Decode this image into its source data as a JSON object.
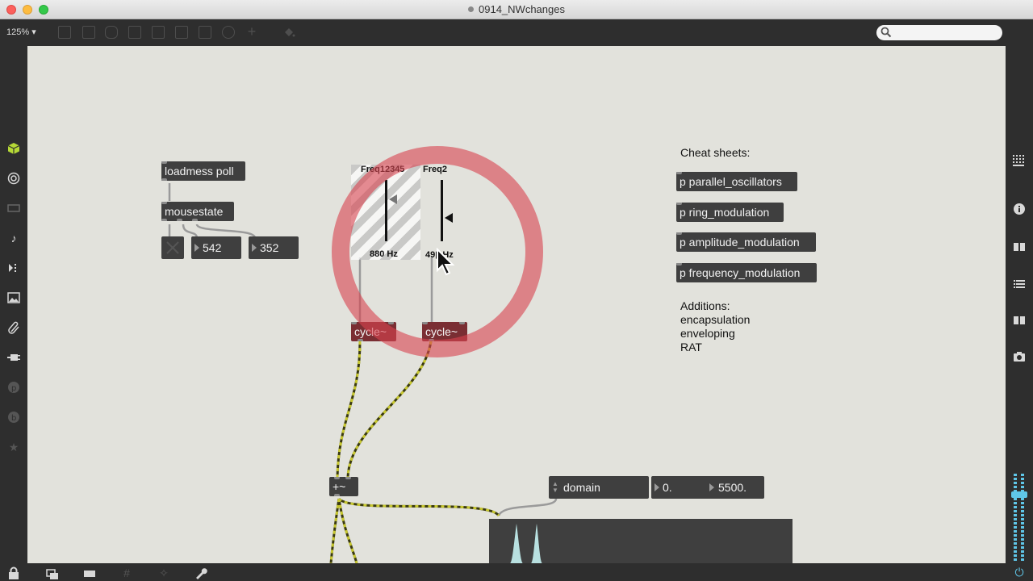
{
  "window": {
    "title": "0914_NWchanges"
  },
  "toolbar": {
    "zoom": "125%",
    "zoom_caret": "▾"
  },
  "patch": {
    "loadmess": "loadmess poll",
    "mousestate": "mousestate",
    "num_x": "542",
    "num_y": "352",
    "slider1": {
      "name": "Freq12345",
      "value": "880 Hz"
    },
    "slider2": {
      "name": "Freq2",
      "value": "49▮ Hz"
    },
    "cycle1": "cycle~",
    "cycle2": "cycle~",
    "plus": "+~",
    "domain": "domain",
    "domain_min": "0.",
    "domain_max": "5500."
  },
  "notes": {
    "cheat_title": "Cheat sheets:",
    "subpatchers": [
      "p parallel_oscillators",
      "p ring_modulation",
      "p amplitude_modulation",
      "p frequency_modulation"
    ],
    "additions_title": "Additions:",
    "additions": [
      "encapsulation",
      "enveloping",
      "RAT"
    ]
  },
  "colors": {
    "accent_red": "#d9434e",
    "patchcord_signal": "#c8c830",
    "canvas": "#e2e2dc"
  }
}
